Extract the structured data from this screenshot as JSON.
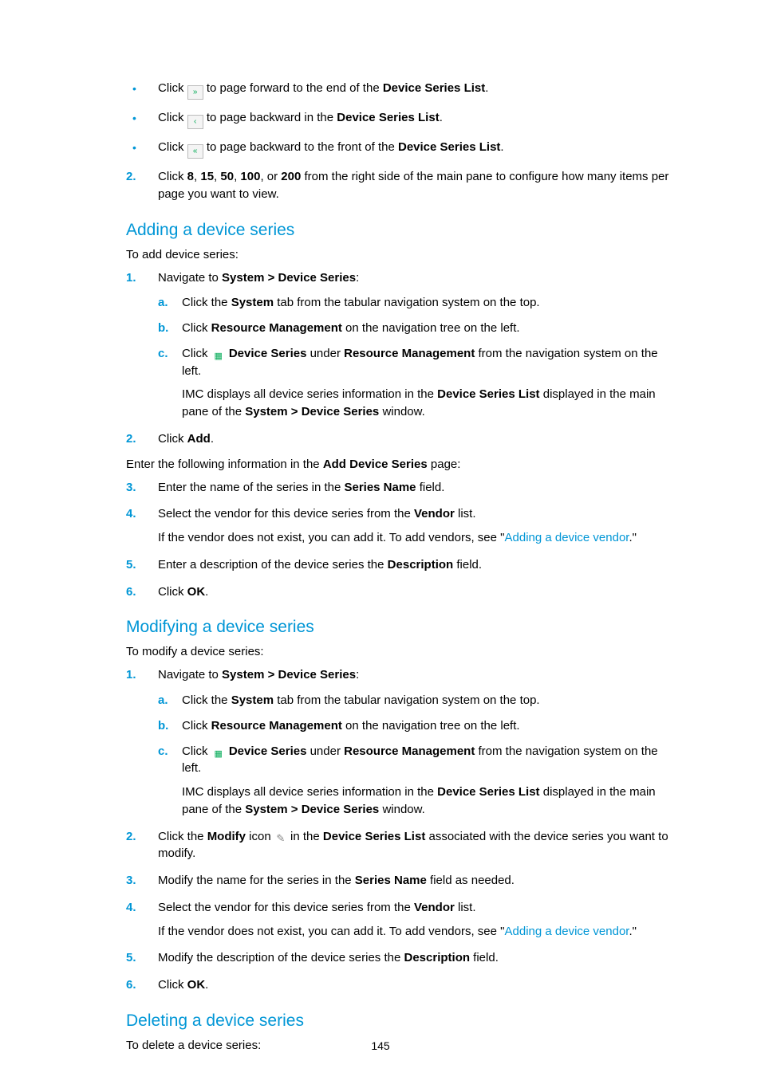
{
  "top_bullets": [
    {
      "pre": "Click ",
      "icon_name": "page-last-icon",
      "icon_glyph": "»",
      "post_parts": [
        " to page forward to the end of the ",
        {
          "b": "Device Series List"
        },
        "."
      ]
    },
    {
      "pre": "Click ",
      "icon_name": "page-prev-icon",
      "icon_glyph": "‹",
      "post_parts": [
        " to page backward in the ",
        {
          "b": "Device Series List"
        },
        "."
      ]
    },
    {
      "pre": "Click ",
      "icon_name": "page-first-icon",
      "icon_glyph": "«",
      "post_parts": [
        " to page backward to the front of the ",
        {
          "b": "Device Series List"
        },
        "."
      ]
    }
  ],
  "top_num": {
    "num": "2.",
    "parts": [
      "Click ",
      {
        "b": "8"
      },
      ", ",
      {
        "b": "15"
      },
      ", ",
      {
        "b": "50"
      },
      ", ",
      {
        "b": "100"
      },
      ", or ",
      {
        "b": "200"
      },
      " from the right side of the main pane to configure how many items per page you want to view."
    ]
  },
  "adding": {
    "heading": "Adding a device series",
    "intro": "To add device series:",
    "steps": [
      {
        "num": "1.",
        "parts": [
          "Navigate to ",
          {
            "b": "System > Device Series"
          },
          ":"
        ],
        "sub": [
          {
            "alph": "a.",
            "parts": [
              "Click the ",
              {
                "b": "System"
              },
              " tab from the tabular navigation system on the top."
            ]
          },
          {
            "alph": "b.",
            "parts": [
              "Click ",
              {
                "b": "Resource Management"
              },
              " on the navigation tree on the left."
            ]
          },
          {
            "alph": "c.",
            "parts": [
              "Click ",
              {
                "icon": "device-series-icon",
                "glyph": "▦"
              },
              " ",
              {
                "b": "Device Series"
              },
              " under ",
              {
                "b": "Resource Management"
              },
              " from the navigation system on the left."
            ],
            "follow": [
              "IMC displays all device series information in the ",
              {
                "b": "Device Series List"
              },
              " displayed in the main pane of the ",
              {
                "b": "System > Device Series"
              },
              " window."
            ]
          }
        ]
      },
      {
        "num": "2.",
        "parts": [
          "Click ",
          {
            "b": "Add"
          },
          "."
        ]
      }
    ],
    "between": [
      "Enter the following information in the ",
      {
        "b": "Add Device Series"
      },
      " page:"
    ],
    "steps2": [
      {
        "num": "3.",
        "parts": [
          "Enter the name of the series in the ",
          {
            "b": "Series Name"
          },
          " field."
        ]
      },
      {
        "num": "4.",
        "parts": [
          "Select the vendor for this device series from the ",
          {
            "b": "Vendor"
          },
          " list."
        ],
        "follow": [
          "If the vendor does not exist, you can add it. To add vendors, see \"",
          {
            "link": "Adding a device vendor"
          },
          ".\""
        ]
      },
      {
        "num": "5.",
        "parts": [
          "Enter a description of the device series the ",
          {
            "b": "Description"
          },
          " field."
        ]
      },
      {
        "num": "6.",
        "parts": [
          "Click ",
          {
            "b": "OK"
          },
          "."
        ]
      }
    ]
  },
  "modifying": {
    "heading": "Modifying a device series",
    "intro": "To modify a device series:",
    "steps": [
      {
        "num": "1.",
        "parts": [
          "Navigate to ",
          {
            "b": "System > Device Series"
          },
          ":"
        ],
        "sub": [
          {
            "alph": "a.",
            "parts": [
              "Click the ",
              {
                "b": "System"
              },
              " tab from the tabular navigation system on the top."
            ]
          },
          {
            "alph": "b.",
            "parts": [
              "Click ",
              {
                "b": "Resource Management"
              },
              " on the navigation tree on the left."
            ]
          },
          {
            "alph": "c.",
            "parts": [
              "Click ",
              {
                "icon": "device-series-icon",
                "glyph": "▦"
              },
              " ",
              {
                "b": "Device Series"
              },
              " under ",
              {
                "b": "Resource Management"
              },
              " from the navigation system on the left."
            ],
            "follow": [
              "IMC displays all device series information in the ",
              {
                "b": "Device Series List"
              },
              " displayed in the main pane of the ",
              {
                "b": "System > Device Series"
              },
              " window."
            ]
          }
        ]
      },
      {
        "num": "2.",
        "parts": [
          "Click the ",
          {
            "b": "Modify"
          },
          " icon ",
          {
            "modicon": true
          },
          " in the ",
          {
            "b": "Device Series List"
          },
          " associated with the device series you want to modify."
        ]
      },
      {
        "num": "3.",
        "parts": [
          "Modify the name for the series in the ",
          {
            "b": "Series Name"
          },
          " field as needed."
        ]
      },
      {
        "num": "4.",
        "parts": [
          "Select the vendor for this device series from the ",
          {
            "b": "Vendor"
          },
          " list."
        ],
        "follow": [
          "If the vendor does not exist, you can add it. To add vendors, see \"",
          {
            "link": "Adding a device vendor"
          },
          ".\""
        ]
      },
      {
        "num": "5.",
        "parts": [
          "Modify the description of the device series the ",
          {
            "b": "Description"
          },
          " field."
        ]
      },
      {
        "num": "6.",
        "parts": [
          "Click ",
          {
            "b": "OK"
          },
          "."
        ]
      }
    ]
  },
  "deleting": {
    "heading": "Deleting a device series",
    "intro": "To delete a device series:"
  },
  "page_number": "145"
}
